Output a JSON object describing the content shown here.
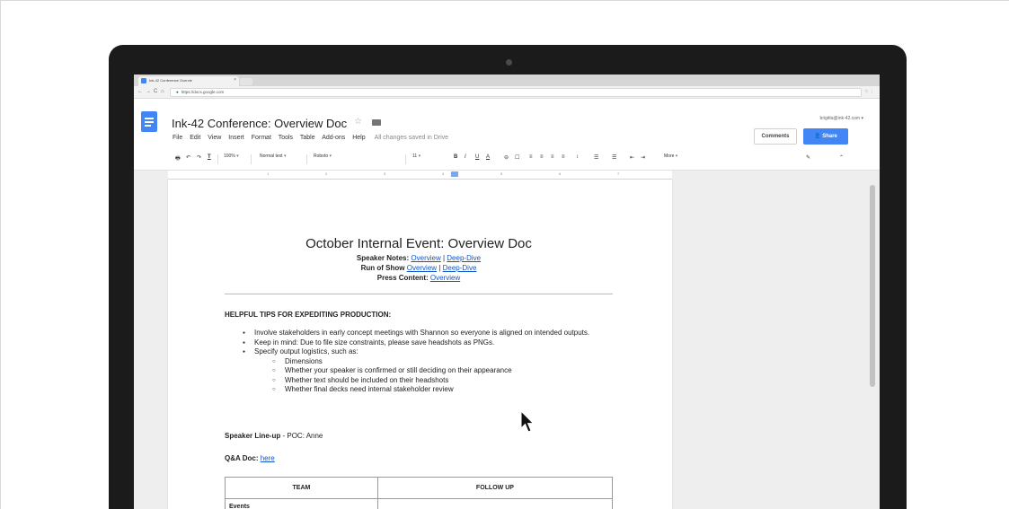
{
  "browser": {
    "tab_title": "Ink-42 Conference Overvie",
    "tab_close": "×",
    "nav_back": "←",
    "nav_forward": "→",
    "nav_reload": "C",
    "nav_home": "⌂",
    "url": "https://docs.google.com",
    "url_right_icons": "☆ ⋮"
  },
  "docs": {
    "title": "Ink-42 Conference: Overview Doc",
    "menu": [
      "File",
      "Edit",
      "View",
      "Insert",
      "Format",
      "Tools",
      "Table",
      "Add-ons",
      "Help"
    ],
    "save_status": "All changes saved in Drive",
    "account": "brigitta@ink-42.com",
    "comments_label": "Comments",
    "share_label": "Share",
    "toolbar": {
      "print": "🖶",
      "undo": "↶",
      "redo": "↷",
      "paint": "T",
      "zoom": "100%",
      "style": "Normal text",
      "font": "Roboto",
      "size": "11",
      "bold": "B",
      "italic": "I",
      "underline": "U",
      "text_color": "A",
      "link": "⊖",
      "comment": "☐",
      "line_spacing": "↕",
      "more": "More",
      "edit_mode": "✎",
      "collapse": "⌃"
    },
    "ruler_numbers": [
      "1",
      "2",
      "3",
      "4",
      "5",
      "6",
      "7"
    ]
  },
  "document": {
    "heading": "October Internal Event: Overview Doc",
    "speaker_notes": {
      "label": "Speaker Notes:",
      "link1": "Overview",
      "sep": "|",
      "link2": "Deep-Dive"
    },
    "run_of_show": {
      "label": "Run of Show",
      "link1": "Overview",
      "sep": "|",
      "link2": "Deep-Dive"
    },
    "press_content": {
      "label": "Press Content:",
      "link1": "Overview"
    },
    "tips_title": "HELPFUL TIPS FOR EXPEDITING PRODUCTION:",
    "bullets": [
      "Involve stakeholders in early concept meetings with Shannon so everyone is aligned on intended outputs.",
      "Keep in mind: Due to file size constraints, please save headshots as PNGs.",
      "Specify output logistics, such as:"
    ],
    "sub_bullets": [
      "Dimensions",
      "Whether your speaker is confirmed or still deciding on their appearance",
      "Whether text should be included on their headshots",
      "Whether final decks need internal stakeholder review"
    ],
    "lineup_label": "Speaker Line-up",
    "lineup_rest": " - POC: Anne",
    "qa_label": "Q&A Doc:",
    "qa_link": "here",
    "table": {
      "headers": [
        "TEAM",
        "FOLLOW UP"
      ],
      "rows": [
        [
          "Events",
          ""
        ]
      ]
    }
  }
}
